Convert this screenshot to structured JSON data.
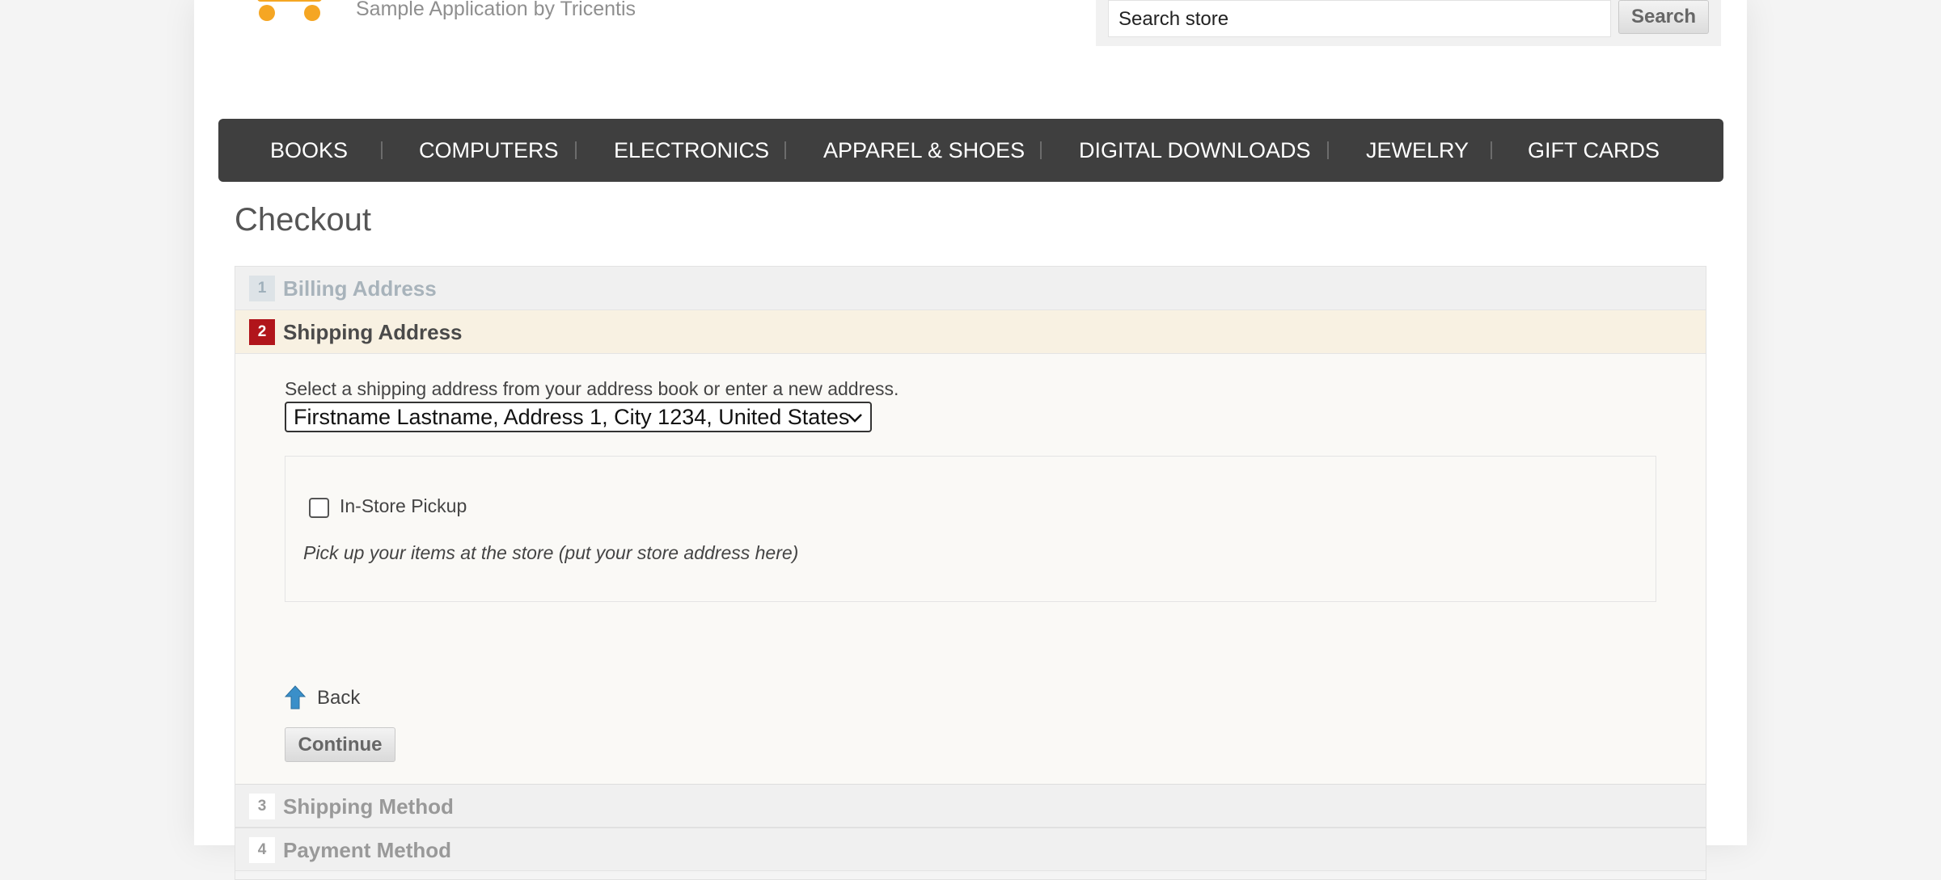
{
  "header": {
    "logo_subtitle": "Sample Application by Tricentis",
    "search": {
      "placeholder": "Search store",
      "button_label": "Search"
    }
  },
  "nav": {
    "items": [
      {
        "label": "BOOKS"
      },
      {
        "label": "COMPUTERS"
      },
      {
        "label": "ELECTRONICS"
      },
      {
        "label": "APPAREL & SHOES"
      },
      {
        "label": "DIGITAL DOWNLOADS"
      },
      {
        "label": "JEWELRY"
      },
      {
        "label": "GIFT CARDS"
      }
    ]
  },
  "page": {
    "title": "Checkout"
  },
  "checkout": {
    "steps": [
      {
        "number": "1",
        "title": "Billing Address",
        "state": "completed"
      },
      {
        "number": "2",
        "title": "Shipping Address",
        "state": "active"
      },
      {
        "number": "3",
        "title": "Shipping Method",
        "state": "pending"
      },
      {
        "number": "4",
        "title": "Payment Method",
        "state": "pending"
      }
    ],
    "shipping": {
      "instruction": "Select a shipping address from your address book or enter a new address.",
      "selected_address": "Firstname Lastname, Address 1, City 1234, United States",
      "pickup_label": "In-Store Pickup",
      "pickup_checked": false,
      "pickup_description": "Pick up your items at the store (put your store address here)",
      "back_label": "Back",
      "continue_label": "Continue"
    }
  },
  "colors": {
    "nav_background": "#3f3f3f",
    "active_step_badge": "#b1151b",
    "active_step_background": "#f8f1e2",
    "logo_accent": "#f5a623",
    "back_arrow": "#3a8fc9"
  }
}
